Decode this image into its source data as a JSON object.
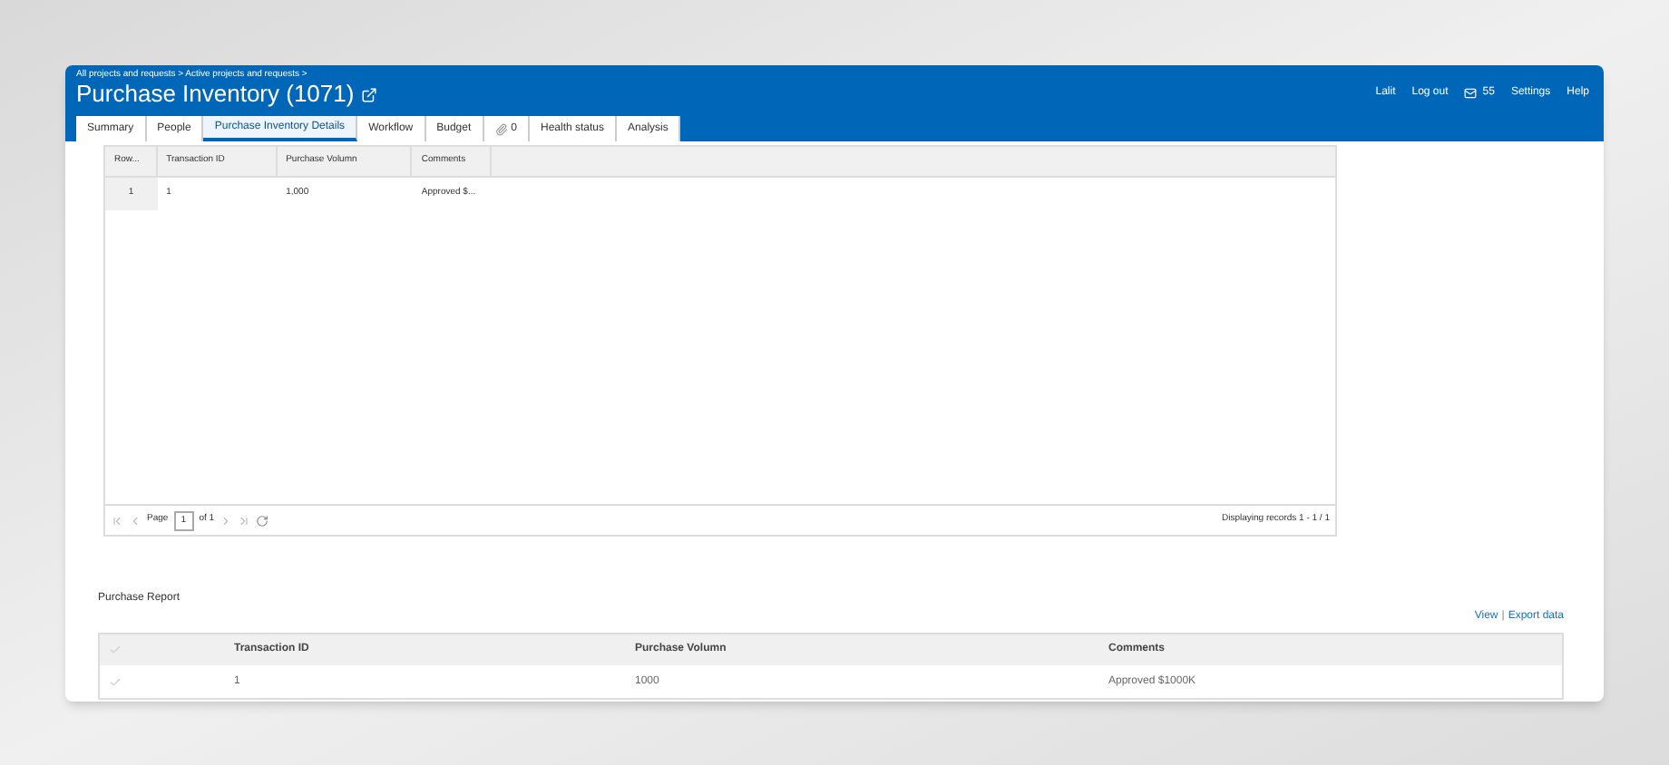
{
  "breadcrumb": "All projects and requests > Active projects and requests >",
  "title": "Purchase Inventory (1071)",
  "user_links": [
    {
      "kind": "text",
      "label": "Lalit"
    },
    {
      "kind": "text",
      "label": "Log out"
    },
    {
      "kind": "mail",
      "label": "55"
    },
    {
      "kind": "text",
      "label": "Settings"
    },
    {
      "kind": "text",
      "label": "Help"
    }
  ],
  "tabs": [
    {
      "kind": "text",
      "label": "Summary",
      "selected": false
    },
    {
      "kind": "text",
      "label": "People",
      "selected": false
    },
    {
      "kind": "text",
      "label": "Purchase Inventory Details",
      "selected": true
    },
    {
      "kind": "text",
      "label": "Workflow",
      "selected": false
    },
    {
      "kind": "text",
      "label": "Budget",
      "selected": false
    },
    {
      "kind": "attachment",
      "label": "0",
      "selected": false
    },
    {
      "kind": "text",
      "label": "Health status",
      "selected": false
    },
    {
      "kind": "text",
      "label": "Analysis",
      "selected": false
    }
  ],
  "grid": {
    "columns": [
      "Row...",
      "Transaction ID",
      "Purchase Volumn",
      "Comments"
    ],
    "rows": [
      [
        "1",
        "1",
        "1,000",
        "Approved $..."
      ]
    ],
    "paging": {
      "page_label": "Page",
      "page": "1",
      "of": "of 1",
      "status": "Displaying records 1 - 1 / 1"
    }
  },
  "report": {
    "title": "Purchase Report",
    "view_link": "View",
    "link_separator": "|",
    "export_link": "Export data",
    "columns": [
      "Transaction ID",
      "Purchase Volumn",
      "Comments"
    ],
    "rows": [
      {
        "checked": false,
        "cells": [
          "1",
          "1000",
          "Approved $1000K"
        ]
      }
    ]
  }
}
